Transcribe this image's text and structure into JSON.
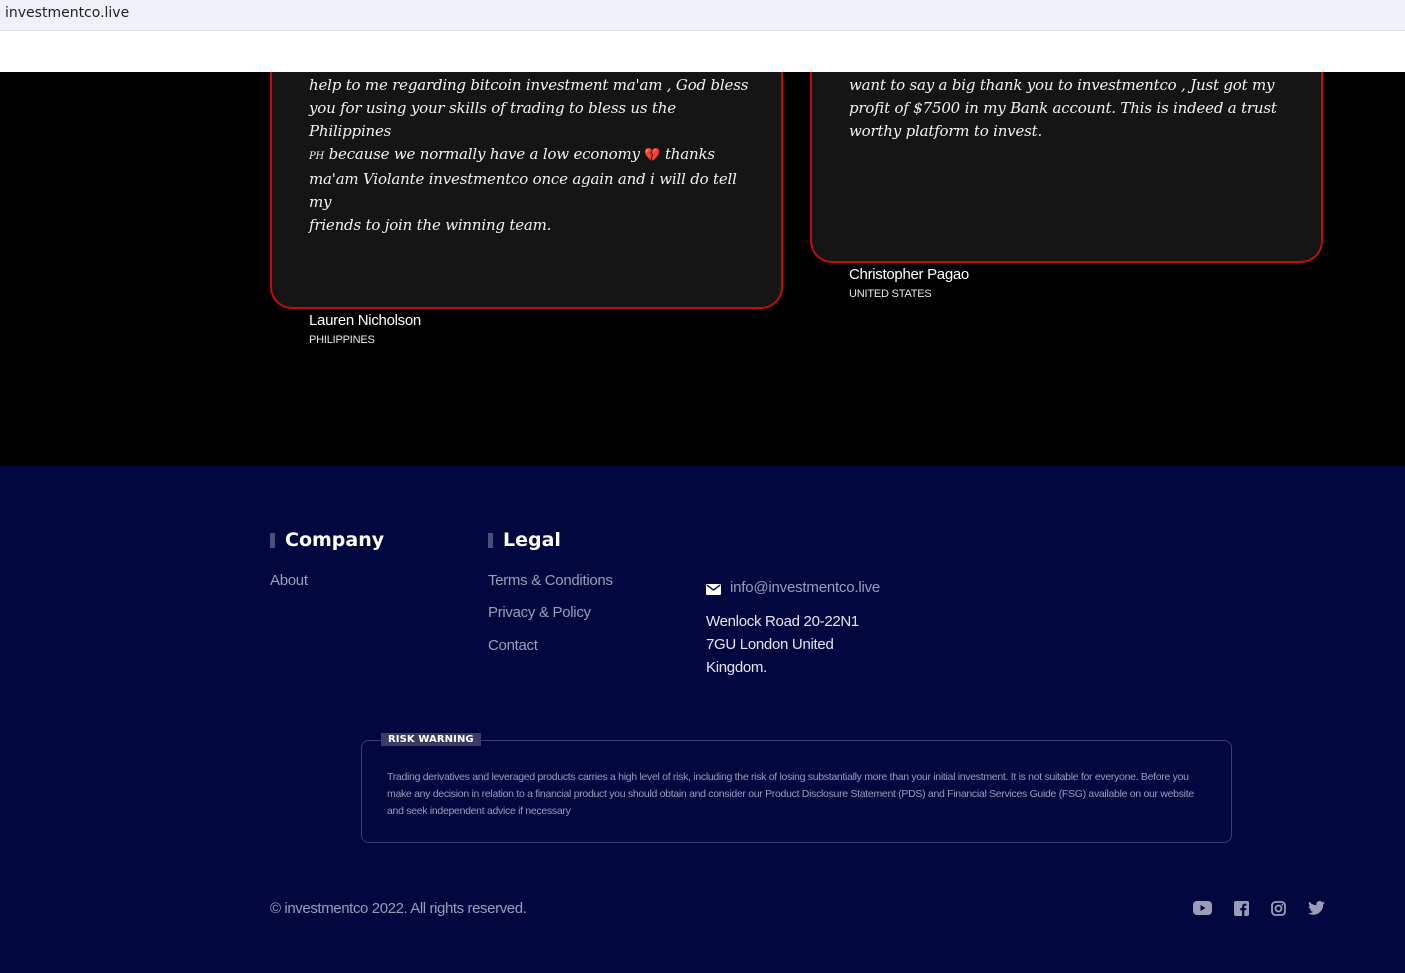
{
  "browser": {
    "url": "investmentco.live"
  },
  "testimonials": [
    {
      "quote_lines": [
        "help to me regarding bitcoin investment ma'am , God bless",
        "you for using your skills of trading to bless us the Philippines",
        "because we normally have a low economy",
        "thanks",
        "ma'am Violante investmentco once again and i will do tell my",
        "friends to join the winning team."
      ],
      "flag_text": "PH",
      "author": "Lauren Nicholson",
      "country": "PHILIPPINES"
    },
    {
      "quote_lines": [
        "want to say a big thank you to investmentco , Just got my",
        "profit of $7500 in my Bank account. This is indeed a trust",
        "worthy platform to invest."
      ],
      "author": "Christopher Pagao",
      "country": "UNITED STATES"
    }
  ],
  "footer": {
    "company": {
      "title": "Company",
      "links": [
        "About"
      ]
    },
    "legal": {
      "title": "Legal",
      "links": [
        "Terms & Conditions",
        "Privacy & Policy",
        "Contact"
      ]
    },
    "contact": {
      "email": "info@investmentco.live",
      "address_lines": [
        "Wenlock Road 20-22N1",
        "7GU London United",
        "Kingdom."
      ]
    },
    "risk_warning": {
      "label": "RISK WARNING",
      "text": "Trading derivatives and leveraged products carries a high level of risk, including the risk of losing substantially more than your initial investment. It is not suitable for everyone. Before you make any decision in relation to a financial product you should obtain and consider our Product Disclosure Statement (PDS) and Financial Services Guide (FSG) available on our website and seek independent advice if necessary"
    },
    "copyright": "© investmentco 2022. All rights reserved.",
    "social_icons": [
      "youtube-icon",
      "facebook-icon",
      "instagram-icon",
      "twitter-icon"
    ]
  },
  "colors": {
    "page_bg": "#000000",
    "card_bg": "#151515",
    "card_border": "#c00d0d",
    "footer_bg": "#030740",
    "muted_text": "#9a9cb8"
  }
}
